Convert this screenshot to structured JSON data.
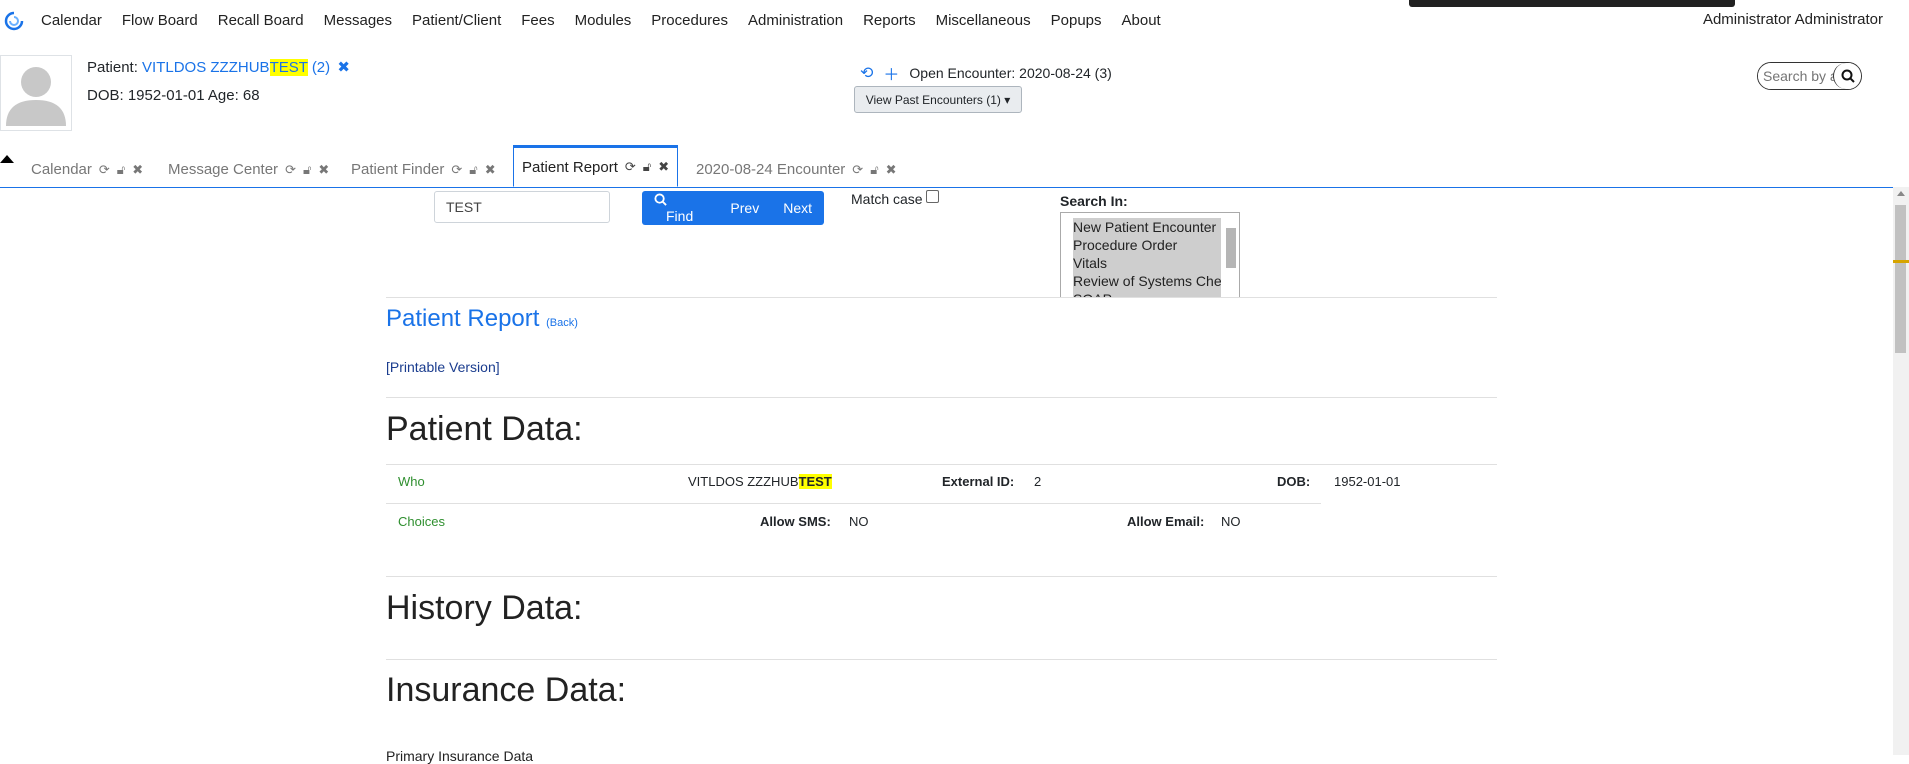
{
  "menu": [
    "Calendar",
    "Flow Board",
    "Recall Board",
    "Messages",
    "Patient/Client",
    "Fees",
    "Modules",
    "Procedures",
    "Administration",
    "Reports",
    "Miscellaneous",
    "Popups",
    "About"
  ],
  "user": "Administrator Administrator",
  "patient": {
    "label": "Patient:",
    "name_prefix": "VITLDOS ZZZHUB",
    "name_highlight": "TEST",
    "pid": "(2)",
    "dob_line": "DOB: 1952-01-01 Age: 68"
  },
  "encounter": {
    "open_label": "Open Encounter:",
    "open_value": "2020-08-24 (3)",
    "past_button": "View Past Encounters",
    "past_count": "(1)"
  },
  "search": {
    "placeholder": "Search by any demographics"
  },
  "tabs": [
    {
      "label": "Calendar"
    },
    {
      "label": "Message Center"
    },
    {
      "label": "Patient Finder"
    },
    {
      "label": "Patient Report"
    },
    {
      "label": "2020-08-24 Encounter"
    }
  ],
  "find": {
    "input_value": "TEST",
    "find_label": "Find",
    "prev_label": "Prev",
    "next_label": "Next",
    "match_case": "Match case",
    "search_in": "Search In:",
    "options": [
      "New Patient Encounter",
      "Procedure Order",
      "Vitals",
      "Review of Systems Checks",
      "SOAP"
    ]
  },
  "report": {
    "title": "Patient Report",
    "back": "(Back)",
    "printable": "[Printable Version]",
    "patient_data_heading": "Patient Data:",
    "history_heading": "History Data:",
    "insurance_heading": "Insurance Data:",
    "primary_insurance": "Primary Insurance Data"
  },
  "patient_data": {
    "who_label": "Who",
    "who_value_prefix": "VITLDOS ZZZHUB",
    "who_value_highlight": "TEST",
    "external_id_label": "External ID:",
    "external_id_value": "2",
    "dob_label": "DOB:",
    "dob_value": "1952-01-01",
    "choices_label": "Choices",
    "allow_sms_label": "Allow SMS:",
    "allow_sms_value": "NO",
    "allow_email_label": "Allow Email:",
    "allow_email_value": "NO"
  }
}
